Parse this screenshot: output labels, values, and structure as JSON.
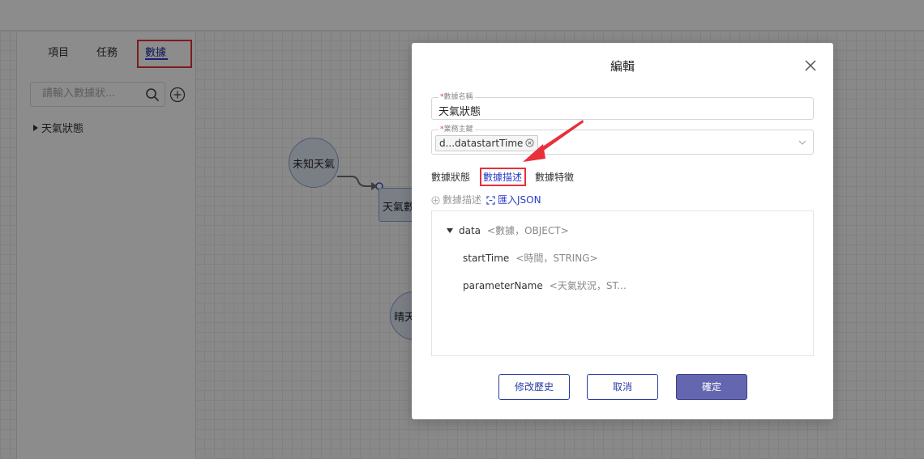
{
  "sidebar": {
    "tabs": [
      {
        "label": "項目"
      },
      {
        "label": "任務"
      },
      {
        "label": "數據"
      }
    ],
    "search_placeholder": "請輸入數據狀...",
    "tree": [
      {
        "label": "天氣狀態"
      }
    ]
  },
  "canvas": {
    "nodes": [
      {
        "label": "未知天氣"
      },
      {
        "label": "天氣數"
      },
      {
        "label": "晴天"
      }
    ]
  },
  "modal": {
    "title": "編輯",
    "fields": {
      "name": {
        "label": "數據名稱",
        "value": "天氣狀態"
      },
      "primary_key": {
        "label": "業務主鍵",
        "tag": "d...datastartTime"
      }
    },
    "tabs": [
      {
        "label": "數據狀態"
      },
      {
        "label": "數據描述"
      },
      {
        "label": "數據特徵"
      }
    ],
    "actions": {
      "add_label": "數據描述",
      "import_label": "匯入JSON"
    },
    "tree": [
      {
        "key": "data",
        "meta": "<數據，OBJECT>"
      },
      {
        "key": "startTime",
        "meta": "<時間，STRING>"
      },
      {
        "key": "parameterName",
        "meta": "<天氣狀況，ST..."
      }
    ],
    "buttons": {
      "history": "修改歷史",
      "cancel": "取消",
      "confirm": "確定"
    }
  },
  "colors": {
    "accent": "#2b3cc8",
    "highlight": "#e8303a",
    "primary_button": "#6466b0"
  }
}
